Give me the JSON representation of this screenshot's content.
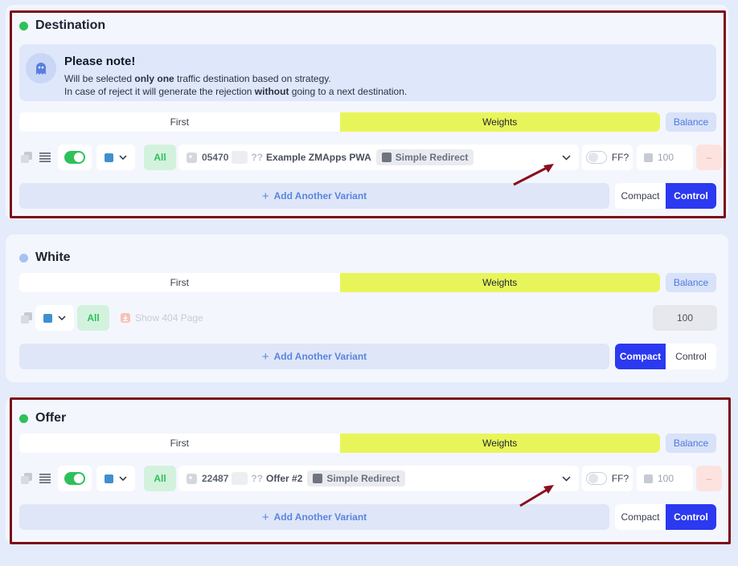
{
  "destination": {
    "title": "Destination",
    "dot_color": "#2ec15a",
    "note": {
      "heading": "Please note!",
      "line1_pre": "Will be selected ",
      "line1_bold": "only one",
      "line1_post": " traffic destination based on strategy.",
      "line2_pre": "In case of reject it will generate the rejection ",
      "line2_bold": "without",
      "line2_post": " going to a next destination."
    },
    "tabs": {
      "first": "First",
      "weights": "Weights",
      "balance": "Balance"
    },
    "row": {
      "all": "All",
      "id": "05470",
      "qq": "??",
      "name": "Example ZMApps PWA",
      "chip": "Simple Redirect",
      "ff": "FF?",
      "weight": "100",
      "remove": "–"
    },
    "add": "Add Another Variant",
    "view": {
      "compact": "Compact",
      "control": "Control",
      "active": "control"
    }
  },
  "white": {
    "title": "White",
    "dot_color": "#a9c0f2",
    "tabs": {
      "first": "First",
      "weights": "Weights",
      "balance": "Balance"
    },
    "row": {
      "all": "All",
      "page": "Show 404 Page",
      "weight": "100"
    },
    "add": "Add Another Variant",
    "view": {
      "compact": "Compact",
      "control": "Control",
      "active": "compact"
    }
  },
  "offer": {
    "title": "Offer",
    "dot_color": "#2ec15a",
    "tabs": {
      "first": "First",
      "weights": "Weights",
      "balance": "Balance"
    },
    "row": {
      "all": "All",
      "id": "22487",
      "qq": "??",
      "name": "Offer #2",
      "chip": "Simple Redirect",
      "ff": "FF?",
      "weight": "100",
      "remove": "–"
    },
    "add": "Add Another Variant",
    "view": {
      "compact": "Compact",
      "control": "Control",
      "active": "control"
    }
  },
  "colors": {
    "accent": "#2b39f0",
    "weights": "#e8f55a",
    "highlight": "#7b0d17"
  }
}
